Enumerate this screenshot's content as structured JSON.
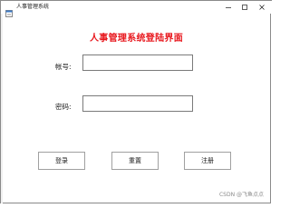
{
  "window": {
    "title": "人事管理系统"
  },
  "form": {
    "heading": "人事管理系统登陆界面",
    "account_label": "帐号:",
    "account_value": "",
    "password_label": "密码:",
    "password_value": ""
  },
  "buttons": {
    "login": "登录",
    "reset": "重置",
    "register": "注册"
  },
  "watermark": "CSDN @飞鱼点点",
  "colors": {
    "heading": "#e8161c",
    "border": "#7a7a7a",
    "background": "#ffffff"
  },
  "icons": {
    "app": "app-window-icon",
    "minimize": "minimize-icon",
    "maximize": "maximize-icon",
    "close": "close-icon"
  }
}
